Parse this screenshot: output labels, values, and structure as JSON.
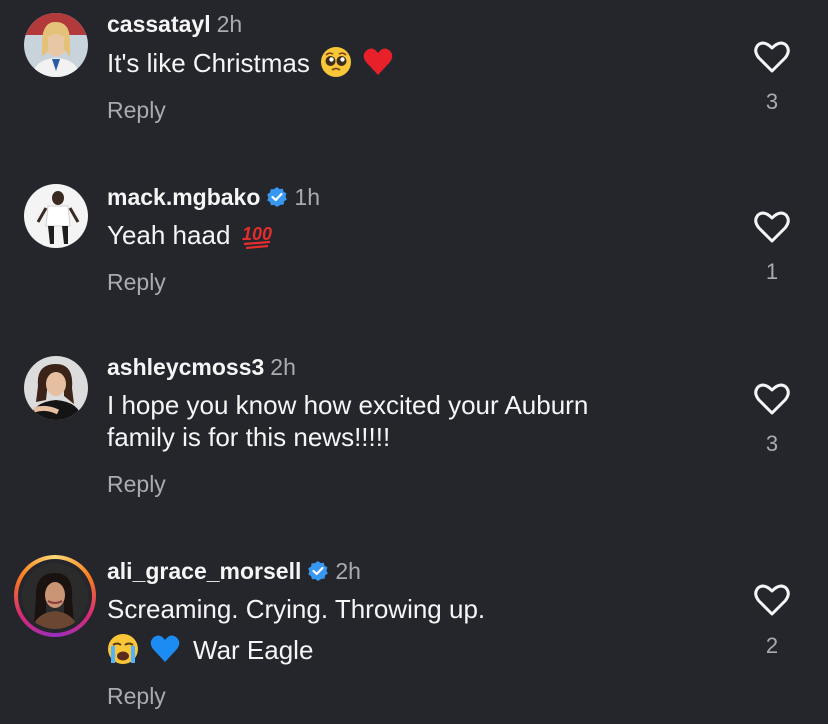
{
  "comments": [
    {
      "username": "cassatayl",
      "verified": false,
      "time": "2h",
      "text": "It's like Christmas",
      "emojis": [
        "pleading-face-emoji",
        "red-heart-emoji"
      ],
      "reply_label": "Reply",
      "like_count": "3"
    },
    {
      "username": "mack.mgbako",
      "verified": true,
      "time": "1h",
      "text": "Yeah haad",
      "emojis": [
        "hundred-points-emoji"
      ],
      "reply_label": "Reply",
      "like_count": "1"
    },
    {
      "username": "ashleycmoss3",
      "verified": false,
      "time": "2h",
      "text_line1": "I hope you know how excited your Auburn",
      "text_line2": "family is for this news!!!!!",
      "reply_label": "Reply",
      "like_count": "3"
    },
    {
      "username": "ali_grace_morsell",
      "verified": true,
      "time": "2h",
      "text_line1": "Screaming. Crying. Throwing up.",
      "text_line2": "War Eagle",
      "emojis": [
        "loudly-crying-face-emoji",
        "blue-heart-emoji"
      ],
      "reply_label": "Reply",
      "like_count": "2"
    }
  ],
  "colors": {
    "background": "#24262c",
    "text": "#f5f5f5",
    "muted": "#a8abb2",
    "verified": "#3897f0"
  }
}
